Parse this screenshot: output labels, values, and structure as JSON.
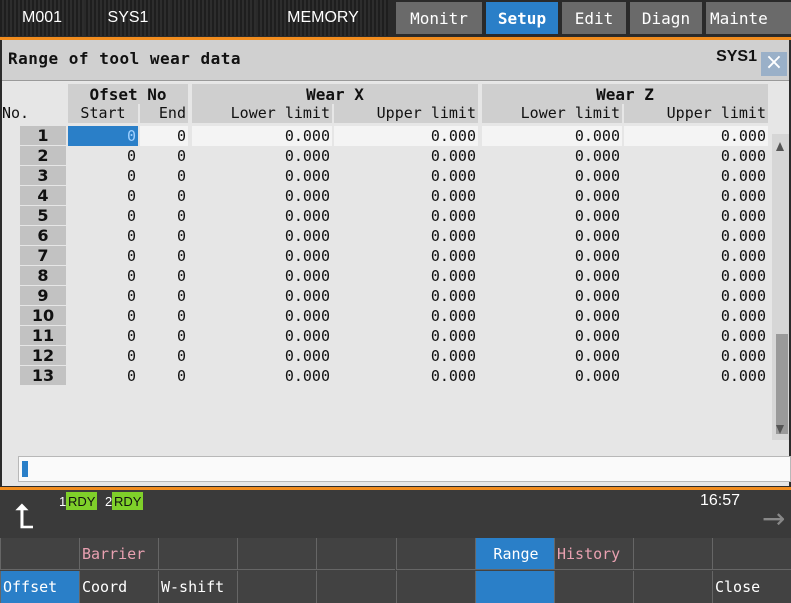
{
  "topbar": {
    "cells": [
      "M001",
      "SYS1",
      "",
      "MEMORY"
    ],
    "tabs": [
      {
        "label": "Monitr",
        "active": false
      },
      {
        "label": "Setup",
        "active": true
      },
      {
        "label": "Edit",
        "active": false
      },
      {
        "label": "Diagn",
        "active": false
      },
      {
        "label": "Mainte",
        "active": false
      }
    ]
  },
  "window": {
    "title": "Range of tool wear data",
    "system": "SYS1",
    "close_label": "×"
  },
  "table": {
    "group_headers": {
      "offset": "Ofset No",
      "wear_x": "Wear X",
      "wear_z": "Wear Z"
    },
    "sub_headers": {
      "no": "No.",
      "start": "Start",
      "end": "End",
      "x_lower": "Lower limit",
      "x_upper": "Upper limit",
      "z_lower": "Lower limit",
      "z_upper": "Upper limit"
    },
    "rows": [
      {
        "no": "1",
        "start": "0",
        "end": "0",
        "x_lower": "0.000",
        "x_upper": "0.000",
        "z_lower": "0.000",
        "z_upper": "0.000"
      },
      {
        "no": "2",
        "start": "0",
        "end": "0",
        "x_lower": "0.000",
        "x_upper": "0.000",
        "z_lower": "0.000",
        "z_upper": "0.000"
      },
      {
        "no": "3",
        "start": "0",
        "end": "0",
        "x_lower": "0.000",
        "x_upper": "0.000",
        "z_lower": "0.000",
        "z_upper": "0.000"
      },
      {
        "no": "4",
        "start": "0",
        "end": "0",
        "x_lower": "0.000",
        "x_upper": "0.000",
        "z_lower": "0.000",
        "z_upper": "0.000"
      },
      {
        "no": "5",
        "start": "0",
        "end": "0",
        "x_lower": "0.000",
        "x_upper": "0.000",
        "z_lower": "0.000",
        "z_upper": "0.000"
      },
      {
        "no": "6",
        "start": "0",
        "end": "0",
        "x_lower": "0.000",
        "x_upper": "0.000",
        "z_lower": "0.000",
        "z_upper": "0.000"
      },
      {
        "no": "7",
        "start": "0",
        "end": "0",
        "x_lower": "0.000",
        "x_upper": "0.000",
        "z_lower": "0.000",
        "z_upper": "0.000"
      },
      {
        "no": "8",
        "start": "0",
        "end": "0",
        "x_lower": "0.000",
        "x_upper": "0.000",
        "z_lower": "0.000",
        "z_upper": "0.000"
      },
      {
        "no": "9",
        "start": "0",
        "end": "0",
        "x_lower": "0.000",
        "x_upper": "0.000",
        "z_lower": "0.000",
        "z_upper": "0.000"
      },
      {
        "no": "10",
        "start": "0",
        "end": "0",
        "x_lower": "0.000",
        "x_upper": "0.000",
        "z_lower": "0.000",
        "z_upper": "0.000"
      },
      {
        "no": "11",
        "start": "0",
        "end": "0",
        "x_lower": "0.000",
        "x_upper": "0.000",
        "z_lower": "0.000",
        "z_upper": "0.000"
      },
      {
        "no": "12",
        "start": "0",
        "end": "0",
        "x_lower": "0.000",
        "x_upper": "0.000",
        "z_lower": "0.000",
        "z_upper": "0.000"
      },
      {
        "no": "13",
        "start": "0",
        "end": "0",
        "x_lower": "0.000",
        "x_upper": "0.000",
        "z_lower": "0.000",
        "z_upper": "0.000"
      }
    ],
    "selected_cell": {
      "row": 1,
      "col": "start"
    }
  },
  "input_line": {
    "value": ""
  },
  "status": {
    "rdy": [
      {
        "num": "1",
        "label": "RDY"
      },
      {
        "num": "2",
        "label": "RDY"
      }
    ],
    "clock": "16:57"
  },
  "softkeys": {
    "top": [
      "",
      "Barrier",
      "",
      "",
      "",
      "",
      "Range",
      "History",
      "",
      ""
    ],
    "bottom": [
      "Offset",
      "Coord",
      "W-shift",
      "",
      "",
      "",
      "",
      "",
      "",
      "Close"
    ],
    "active_top_index": 6
  },
  "colors": {
    "accent": "#2a7fc8",
    "frame_orange": "#f08c1e",
    "rdy_green": "#7fd02a",
    "softkey_top_text": "#e8a0b0"
  }
}
